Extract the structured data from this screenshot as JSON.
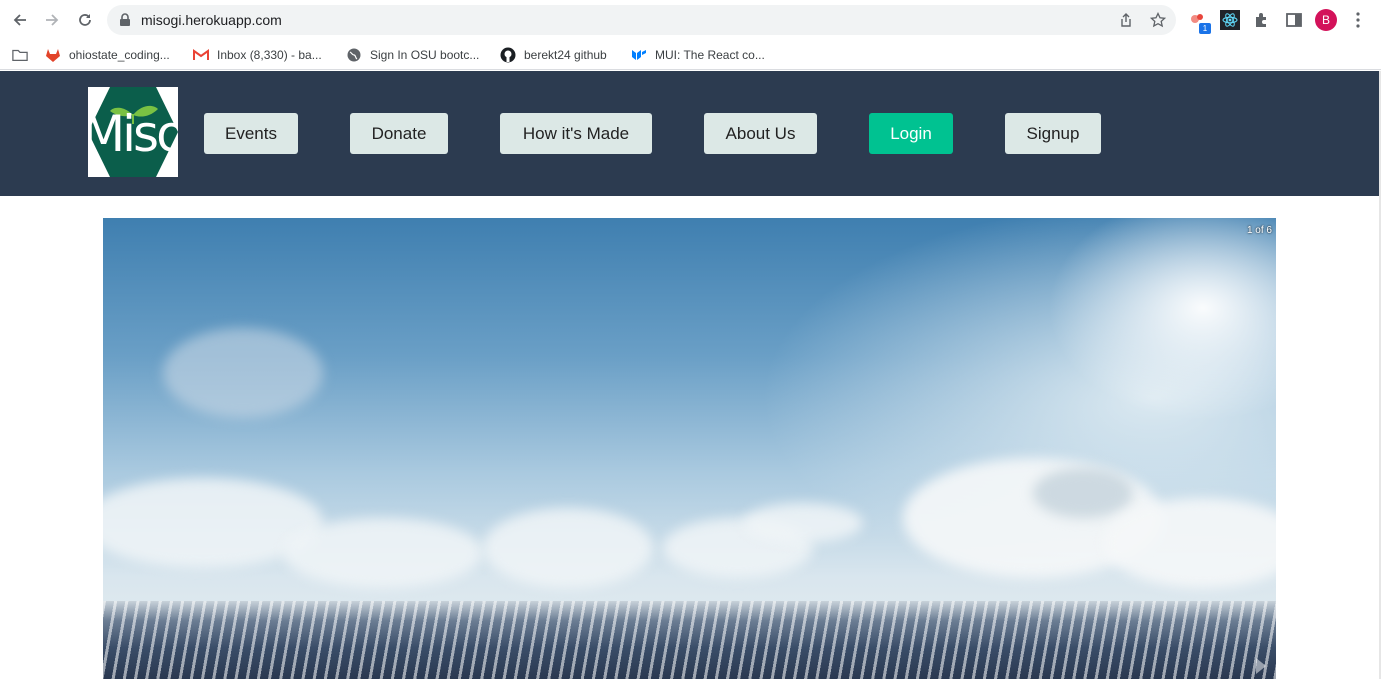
{
  "browser": {
    "url": "misogi.herokuapp.com",
    "extension_badge": "1",
    "profile_initial": "B",
    "bookmarks": [
      {
        "label": "ohiostate_coding...",
        "icon": "gitlab-icon"
      },
      {
        "label": "Inbox (8,330) - ba...",
        "icon": "gmail-icon"
      },
      {
        "label": "Sign In OSU bootc...",
        "icon": "globe-icon"
      },
      {
        "label": "berekt24 github",
        "icon": "github-icon"
      },
      {
        "label": "MUI: The React co...",
        "icon": "mui-icon"
      }
    ]
  },
  "site": {
    "logo_text": "Misogi",
    "nav": {
      "events": "Events",
      "donate": "Donate",
      "how_made": "How it's Made",
      "about": "About Us",
      "login": "Login",
      "signup": "Signup"
    },
    "colors": {
      "header_bg": "#2c3b50",
      "nav_button_bg": "#dce8e6",
      "login_bg": "#00c291",
      "logo_green": "#0b5e4b"
    }
  },
  "carousel": {
    "counter": "1 of 6",
    "image": "ocean-sky-image",
    "current_slide": 1,
    "total_slides": 6
  }
}
